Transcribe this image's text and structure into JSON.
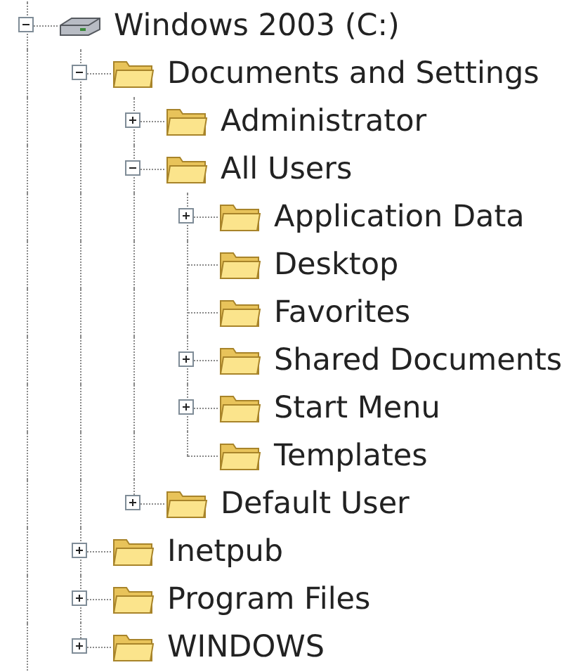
{
  "tree": [
    {
      "label": "Windows 2003 (C:)",
      "kind": "drive",
      "expanded": true,
      "children": [
        {
          "label": "Documents and Settings",
          "kind": "folder",
          "expanded": true,
          "children": [
            {
              "label": "Administrator",
              "kind": "folder",
              "expanded": false
            },
            {
              "label": "All Users",
              "kind": "folder",
              "expanded": true,
              "children": [
                {
                  "label": "Application Data",
                  "kind": "folder",
                  "expanded": false
                },
                {
                  "label": "Desktop",
                  "kind": "folder"
                },
                {
                  "label": "Favorites",
                  "kind": "folder"
                },
                {
                  "label": "Shared Documents",
                  "kind": "folder",
                  "expanded": false
                },
                {
                  "label": "Start Menu",
                  "kind": "folder",
                  "expanded": false
                },
                {
                  "label": "Templates",
                  "kind": "folder"
                }
              ]
            },
            {
              "label": "Default User",
              "kind": "folder",
              "expanded": false
            }
          ]
        },
        {
          "label": "Inetpub",
          "kind": "folder",
          "expanded": false
        },
        {
          "label": "Program Files",
          "kind": "folder",
          "expanded": false
        },
        {
          "label": "WINDOWS",
          "kind": "folder",
          "expanded": false
        }
      ]
    }
  ]
}
